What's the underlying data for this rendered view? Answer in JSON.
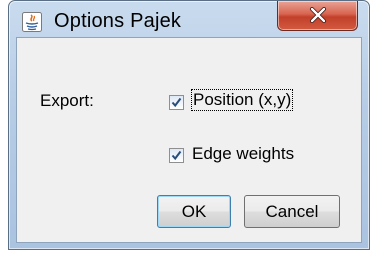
{
  "window": {
    "title": "Options Pajek",
    "app_icon": "java-icon",
    "close_icon": "close-icon"
  },
  "export": {
    "label": "Export:",
    "options": [
      {
        "label": "Position (x,y)",
        "checked": true
      },
      {
        "label": "Edge weights",
        "checked": true
      }
    ]
  },
  "buttons": {
    "ok_label": "OK",
    "cancel_label": "Cancel"
  }
}
